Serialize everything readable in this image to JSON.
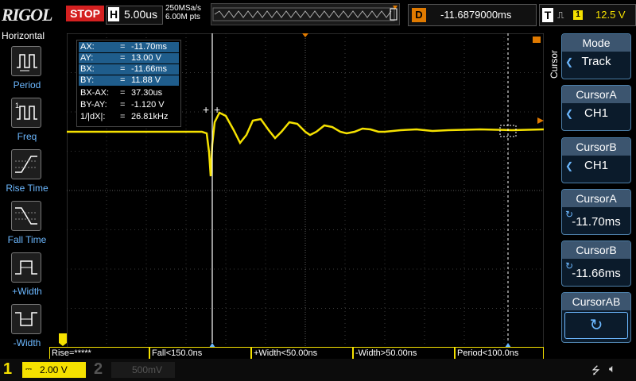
{
  "header": {
    "brand": "RIGOL",
    "run_state": "STOP",
    "horizontal": {
      "label": "H",
      "timebase": "5.00us"
    },
    "sample_rate": "250MSa/s",
    "memory_depth": "6.00M pts",
    "delay": {
      "label": "D",
      "value": "-11.6879000ms"
    },
    "trigger": {
      "label": "T",
      "slope_icon": "rising-edge-icon",
      "source": "1",
      "level": "12.5 V"
    }
  },
  "left_menu": {
    "title": "Horizontal",
    "items": [
      {
        "label": "Period",
        "icon": "period-icon"
      },
      {
        "label": "Freq",
        "icon": "frequency-icon"
      },
      {
        "label": "Rise Time",
        "icon": "rise-time-icon"
      },
      {
        "label": "Fall Time",
        "icon": "fall-time-icon"
      },
      {
        "label": "+Width",
        "icon": "positive-width-icon"
      },
      {
        "label": "-Width",
        "icon": "negative-width-icon"
      }
    ]
  },
  "cursor_readout": {
    "rows": [
      {
        "key": "AX:",
        "value": "-11.70ms"
      },
      {
        "key": "AY:",
        "value": "13.00 V"
      },
      {
        "key": "BX:",
        "value": "-11.66ms"
      },
      {
        "key": "BY:",
        "value": "11.88 V"
      },
      {
        "key": "BX-AX:",
        "value": "37.30us"
      },
      {
        "key": "BY-AY:",
        "value": "-1.120 V"
      },
      {
        "key": "1/|dX|:",
        "value": "26.81kHz"
      }
    ],
    "equals": "="
  },
  "right_menu": {
    "title": "Cursor",
    "buttons": [
      {
        "header": "Mode",
        "value": "Track"
      },
      {
        "header": "CursorA",
        "value": "CH1"
      },
      {
        "header": "CursorB",
        "value": "CH1"
      },
      {
        "header": "CursorA",
        "value": "-11.70ms"
      },
      {
        "header": "CursorB",
        "value": "-11.66ms"
      },
      {
        "header": "CursorAB",
        "value": ""
      }
    ]
  },
  "measurements": [
    {
      "text": "Rise=*****"
    },
    {
      "text": "Fall<150.0ns"
    },
    {
      "text": "+Width<50.00ns"
    },
    {
      "text": "-Width>50.00ns"
    },
    {
      "text": "Period<100.0ns"
    }
  ],
  "channels": {
    "ch1": {
      "number": "1",
      "scale": "2.00 V"
    },
    "ch2": {
      "number": "2",
      "scale": "500mV"
    }
  },
  "colors": {
    "ch1": "#f5e100",
    "trigger_marker": "#e07a00",
    "grid": "#3a3a3a",
    "menu_accent": "#3c556f",
    "stop": "#d42020"
  }
}
